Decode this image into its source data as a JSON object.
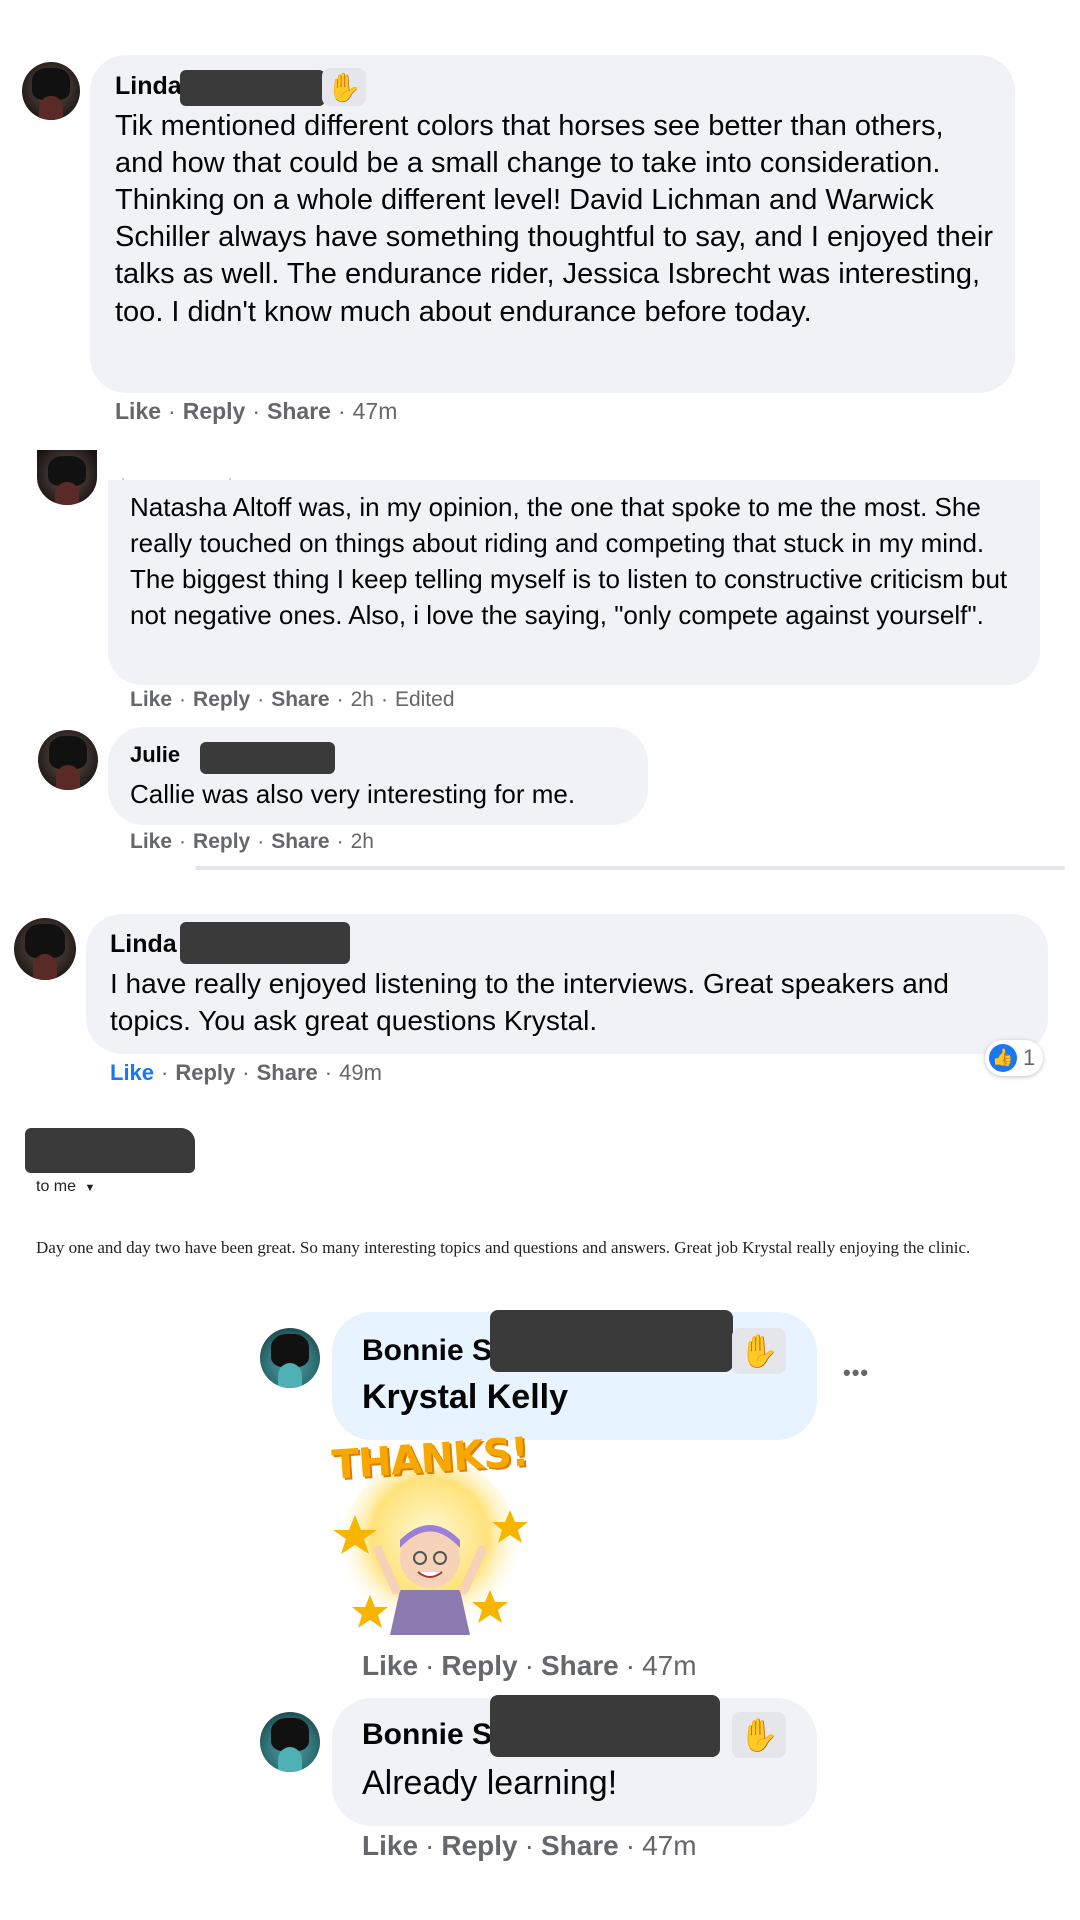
{
  "comment1": {
    "author": "Linda",
    "badge_icon": "wave-icon",
    "text": "Tik mentioned different colors that horses see better than others, and how that could be a small change to take into consideration. Thinking on a whole different level! David Lichman and Warwick Schiller always have something thoughtful to say, and I enjoyed their talks as well. The endurance rider, Jessica Isbrecht was interesting, too. I didn't know much about endurance before today.",
    "actions": {
      "like": "Like",
      "reply": "Reply",
      "share": "Share",
      "sep": "·",
      "time": "47m"
    }
  },
  "comment2": {
    "text": "Natasha Altoff was, in my opinion, the one that spoke to me the most. She really touched on things about riding and competing that stuck in my mind. The biggest thing I keep telling myself is to listen to constructive criticism but not negative ones. Also, i love the saying, \"only compete against yourself\".",
    "actions": {
      "like": "Like",
      "reply": "Reply",
      "share": "Share",
      "sep": "·",
      "time": "2h",
      "edited": "Edited"
    }
  },
  "comment3": {
    "author": "Julie",
    "text": "Callie was also very interesting for me.",
    "actions": {
      "like": "Like",
      "reply": "Reply",
      "share": "Share",
      "sep": "·",
      "time": "2h"
    }
  },
  "comment4": {
    "author": "Linda",
    "text": "I have really enjoyed listening to the interviews. Great speakers and topics. You ask great questions Krystal.",
    "actions": {
      "like": "Like",
      "reply": "Reply",
      "share": "Share",
      "sep": "·",
      "time": "49m"
    },
    "reaction": {
      "icon": "thumbs-up-icon",
      "count": "1"
    }
  },
  "email": {
    "to_label": "to me",
    "body": "Day one and day two have been great. So many interesting topics and questions and answers. Great job Krystal really enjoying the clinic."
  },
  "comment5": {
    "author": "Bonnie S",
    "mention": "Krystal Kelly",
    "sticker_text": "THANKS!",
    "more_label": "•••",
    "actions": {
      "like": "Like",
      "reply": "Reply",
      "share": "Share",
      "sep": "·",
      "time": "47m"
    }
  },
  "comment6": {
    "author": "Bonnie S",
    "text": "Already learning!",
    "actions": {
      "like": "Like",
      "reply": "Reply",
      "share": "Share",
      "sep": "·",
      "time": "47m"
    }
  },
  "colors": {
    "bubble": "#f0f2f5",
    "mention_bubble": "#e7f3ff",
    "link_blue": "#1877f2",
    "meta_gray": "#65676b"
  }
}
